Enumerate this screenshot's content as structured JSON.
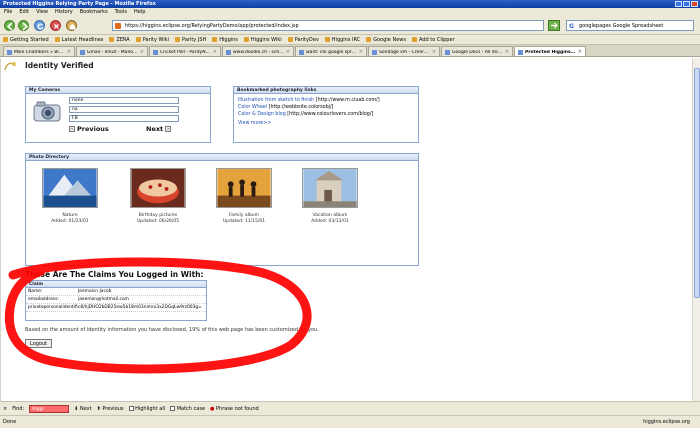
{
  "window": {
    "title": "Protected Higgins Relying Party Page - Mozilla Firefox"
  },
  "menu": [
    "File",
    "Edit",
    "View",
    "History",
    "Bookmarks",
    "Tools",
    "Help"
  ],
  "navigation": {
    "url": "https://higgins.eclipse.org/RelyingPartyDemo/app/protected/index.jsp",
    "search_value": "googlepages Google Spreadsheet"
  },
  "bookmarks_bar": [
    "Getting Started",
    "Latest Headlines",
    "ZERA",
    "Parity Wiki",
    "Parity JSH",
    "Higgins",
    "Higgins Wiki",
    "ParityDev",
    "Higgins IRC",
    "Google News",
    "Add to Clipper"
  ],
  "tabs": [
    {
      "label": "Mike Chambers » Blog Archiv...",
      "active": false
    },
    {
      "label": "Gmail - erkut - Manoj Kumar h...",
      "active": false
    },
    {
      "label": "Cricket Poll - ParityNet | Learn ...",
      "active": false
    },
    {
      "label": "www.doodle.ch - scheduling ...",
      "active": false
    },
    {
      "label": "want: ink google spreadshee...",
      "active": false
    },
    {
      "label": "Sondage vm - Créer un form...",
      "active": false
    },
    {
      "label": "Google Docs - All items",
      "active": false
    },
    {
      "label": "Protected Higgins Relying ...",
      "active": true
    }
  ],
  "page": {
    "title": "Identity Verified",
    "cameras": {
      "header": "My Cameras",
      "fields": [
        "none",
        "na",
        "FB"
      ],
      "previous_label": "Previous",
      "next_label": "Next"
    },
    "bookmarked": {
      "header": "Bookmarked photography links",
      "links": [
        {
          "text": "Illustration from sketch to finish",
          "url": " [http://www.m.ciuab.com/]"
        },
        {
          "text": "Color Wheel",
          "url": " [http://webbsite.colorsobj/]"
        },
        {
          "text": "Color & Design blog",
          "url": " [http://www.colourlovers.com/blog/]"
        }
      ],
      "view_more": "View more>>"
    },
    "photo_directory": {
      "header": "Photo Directory",
      "albums": [
        {
          "name": "Nature",
          "date": "Added: 01/23/01"
        },
        {
          "name": "Birthday pictures",
          "date": "Updated: 06/26/05"
        },
        {
          "name": "Family album",
          "date": "Updated: 11/15/01"
        },
        {
          "name": "Vacation album",
          "date": "Added: 03/13/01"
        }
      ]
    },
    "claims": {
      "title": "These Are The Claims You Logged in With:",
      "header": "Claim",
      "rows": [
        {
          "key": "Name:",
          "value": "Jeemaicn Jacob"
        },
        {
          "key": "emailaddress:",
          "value": "jaeemon@hotmail.com"
        },
        {
          "key": "privatepersonalidentifier:",
          "value": "c8/hjDHO2bDB25ew5b18m03nimrx3x2DGqLw9rz003g="
        }
      ]
    },
    "disclosure": "Based on the amount of identity information you have disclosed, 19% of this web page has been customized for you.",
    "logout_label": "Logout"
  },
  "find_bar": {
    "label": "Find:",
    "value": "Higgi",
    "next_label": "Next",
    "previous_label": "Previous",
    "highlight_label": "Highlight all",
    "match_case_label": "Match case",
    "not_found_label": "Phrase not found"
  },
  "status": {
    "left": "Done",
    "right": "higgins.eclipse.org"
  },
  "colors": {
    "titlebar": "#0d3fa3",
    "panel_border": "#8aa6cf",
    "scribble": "#ff0000",
    "find_not_found": "#ff6c6c"
  }
}
